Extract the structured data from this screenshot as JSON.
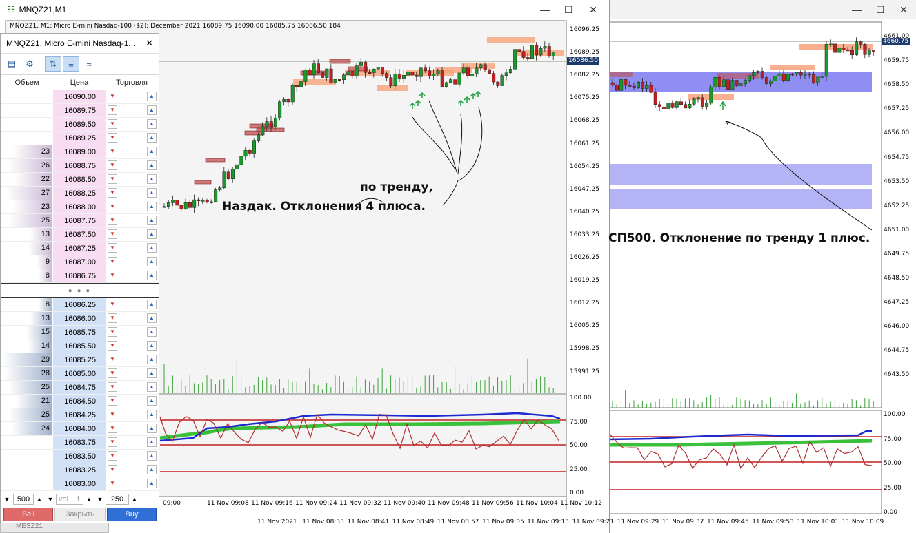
{
  "left_window": {
    "title": "MNQZ21,M1",
    "info_line": "MNQZ21, M1:  Micro E-mini Nasdaq-100 ($2): December 2021  16089.75 16090.00 16085.75 16086.50  184",
    "price_axis": [
      "16096.25",
      "16089.25",
      "16082.25",
      "16075.25",
      "16068.25",
      "16061.25",
      "16054.25",
      "16047.25",
      "16040.25",
      "16033.25",
      "16026.25",
      "16019.25",
      "16012.25",
      "16005.25",
      "15998.25",
      "15991.25"
    ],
    "current_price": "16086.50",
    "ind_axis": [
      "100.00",
      "75.00",
      "50.00",
      "25.00",
      "0.00"
    ],
    "time_axis": [
      "09:00",
      "11 Nov 09:08",
      "11 Nov 09:16",
      "11 Nov 09:24",
      "11 Nov 09:32",
      "11 Nov 09:40",
      "11 Nov 09:48",
      "11 Nov 09:56",
      "11 Nov 10:04",
      "11 Nov 10:12"
    ],
    "annotation_trend": "по тренду,",
    "annotation_main": "Наздак. Отклонения 4 плюса."
  },
  "right_window": {
    "price_axis": [
      "4661.00",
      "4659.75",
      "4658.50",
      "4657.25",
      "4656.00",
      "4654.75",
      "4653.50",
      "4652.25",
      "4651.00",
      "4649.75",
      "4648.50",
      "4647.25",
      "4646.00",
      "4644.75",
      "4643.50"
    ],
    "current_price": "4660.75",
    "ind_axis": [
      "100.00",
      "75.00",
      "50.00",
      "25.00",
      "0.00"
    ],
    "time_axis": [
      "11 Nov 2021",
      "11 Nov 08:33",
      "11 Nov 08:41",
      "11 Nov 08:49",
      "11 Nov 08:57",
      "11 Nov 09:05",
      "11 Nov 09:13",
      "11 Nov 09:21",
      "11 Nov 09:29",
      "11 Nov 09:37",
      "11 Nov 09:45",
      "11 Nov 09:53",
      "11 Nov 10:01",
      "11 Nov 10:09"
    ],
    "annotation_main": "СП500. Отклонение по тренду 1 плюс."
  },
  "dom": {
    "title": "MNQZ21, Micro E-mini Nasdaq-1...",
    "col_volume": "Объем",
    "col_price": "Цена",
    "col_trade": "Торговля",
    "asks": [
      {
        "price": "16090.00",
        "vol": ""
      },
      {
        "price": "16089.75",
        "vol": ""
      },
      {
        "price": "16089.50",
        "vol": ""
      },
      {
        "price": "16089.25",
        "vol": ""
      },
      {
        "price": "16089.00",
        "vol": "23"
      },
      {
        "price": "16088.75",
        "vol": "26"
      },
      {
        "price": "16088.50",
        "vol": "22"
      },
      {
        "price": "16088.25",
        "vol": "27"
      },
      {
        "price": "16088.00",
        "vol": "23"
      },
      {
        "price": "16087.75",
        "vol": "25"
      },
      {
        "price": "16087.50",
        "vol": "13"
      },
      {
        "price": "16087.25",
        "vol": "14"
      },
      {
        "price": "16087.00",
        "vol": "9"
      },
      {
        "price": "16086.75",
        "vol": "8"
      }
    ],
    "bids": [
      {
        "price": "16086.25",
        "vol": "8"
      },
      {
        "price": "16086.00",
        "vol": "13"
      },
      {
        "price": "16085.75",
        "vol": "15"
      },
      {
        "price": "16085.50",
        "vol": "14"
      },
      {
        "price": "16085.25",
        "vol": "29"
      },
      {
        "price": "16085.00",
        "vol": "28"
      },
      {
        "price": "16084.75",
        "vol": "25"
      },
      {
        "price": "16084.50",
        "vol": "21"
      },
      {
        "price": "16084.25",
        "vol": "25"
      },
      {
        "price": "16084.00",
        "vol": "24"
      },
      {
        "price": "16083.75",
        "vol": ""
      },
      {
        "price": "16083.50",
        "vol": ""
      },
      {
        "price": "16083.25",
        "vol": ""
      },
      {
        "price": "16083.00",
        "vol": ""
      }
    ],
    "qty_left": "500",
    "qty_vol": "vol",
    "qty_vol_val": "1",
    "qty_right": "250",
    "sell_label": "Sell",
    "close_label": "Закрыть",
    "buy_label": "Buy",
    "colors": {
      "ask_bar": "#c9b9d4",
      "bid_bar": "#9fb0cc",
      "sell": "#e06a6a",
      "buy": "#2f6fd6"
    }
  },
  "bottom_tab": "MESZ21"
}
